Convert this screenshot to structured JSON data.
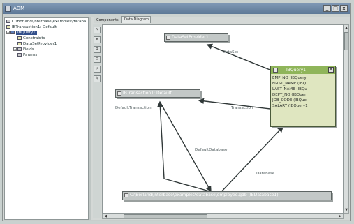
{
  "window": {
    "title": "ADM",
    "btn_min": "_",
    "btn_max": "□",
    "btn_close": "x"
  },
  "tree": {
    "rows": [
      "C:\\Borland\\Interbase\\examples\\databa",
      "IBTransaction1: Default",
      "IBQuery1",
      "Constraints",
      "DataSetProvider1",
      "Fields",
      "Params"
    ]
  },
  "tabs": [
    "Components",
    "Data Diagram"
  ],
  "tools": [
    "↖",
    "⌖",
    "⊞",
    "⊡",
    "⚡",
    "✎"
  ],
  "diagram": {
    "nodes": {
      "provider": "DataSetProvider1",
      "transaction": "IBTransaction1: Default",
      "database": "C:\\Borland\\Interbase\\examples\\database\\employee.gdb (IBDatabase1)"
    },
    "query": {
      "title": "IBQuery1",
      "close": "x",
      "fields": [
        "EMP_NO (IBQuery",
        "FIRST_NAME (IBQ",
        "LAST_NAME (IBQu",
        "DEPT_NO (IBQuer",
        "JOB_CODE (IBQue",
        "SALARY (IBQuery1"
      ]
    },
    "edge_labels": {
      "dataset": "DataSet",
      "default_transaction": "DefaultTransaction",
      "transaction": "Transaction",
      "default_database": "DefaultDatabase",
      "database": "Database"
    }
  },
  "colors": {
    "title_bar": "#6b84a3",
    "query_header": "#8fb55a",
    "edge": "#303838"
  }
}
